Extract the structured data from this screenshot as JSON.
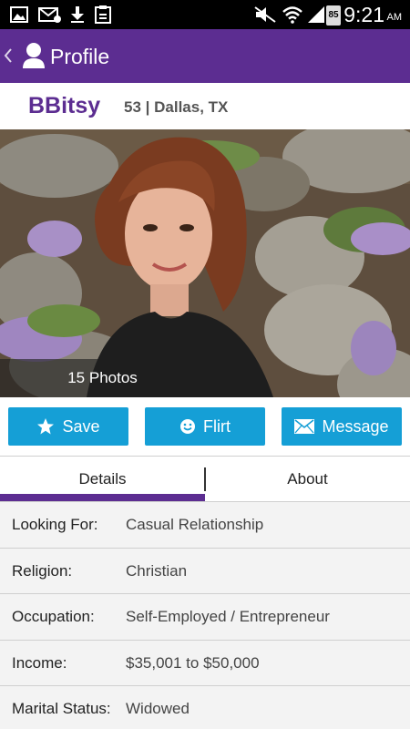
{
  "status_bar": {
    "time": "9:21",
    "ampm": "AM",
    "battery": "85",
    "icons": [
      "gallery-icon",
      "mail-icon",
      "download-icon",
      "clipboard-icon",
      "mute-icon",
      "wifi-icon",
      "signal-icon"
    ]
  },
  "app_bar": {
    "title": "Profile"
  },
  "profile": {
    "name": "BBitsy",
    "meta": "53 | Dallas, TX",
    "photo_count_label": "15 Photos"
  },
  "actions": {
    "save_label": "Save",
    "flirt_label": "Flirt",
    "message_label": "Message"
  },
  "tabs": [
    {
      "label": "Details",
      "active": true
    },
    {
      "label": "About",
      "active": false
    }
  ],
  "details": [
    {
      "label": "Looking For:",
      "value": "Casual Relationship"
    },
    {
      "label": "Religion:",
      "value": "Christian"
    },
    {
      "label": "Occupation:",
      "value": "Self-Employed / Entrepreneur"
    },
    {
      "label": "Income:",
      "value": "$35,001 to $50,000"
    },
    {
      "label": "Marital Status:",
      "value": "Widowed"
    }
  ],
  "colors": {
    "brand": "#5c2d91",
    "button": "#159fd6"
  }
}
